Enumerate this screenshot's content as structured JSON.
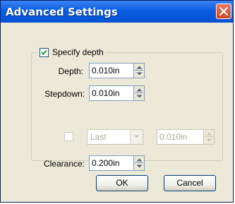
{
  "window": {
    "title": "Advanced Settings"
  },
  "group": {
    "legend_label": "Specify depth",
    "legend_checked": true
  },
  "depth": {
    "label": "Depth:",
    "value": "0.010in"
  },
  "stepdown": {
    "label": "Stepdown:",
    "value": "0.010in"
  },
  "last_pass": {
    "checked": false,
    "mode": "Last",
    "value": "0.010in"
  },
  "clearance": {
    "label": "Clearance:",
    "value": "0.200in"
  },
  "buttons": {
    "ok": "OK",
    "cancel": "Cancel"
  },
  "colors": {
    "titlebar": "#0a5fe0",
    "close_button": "#d04520",
    "dialog_bg": "#ece9d8"
  }
}
